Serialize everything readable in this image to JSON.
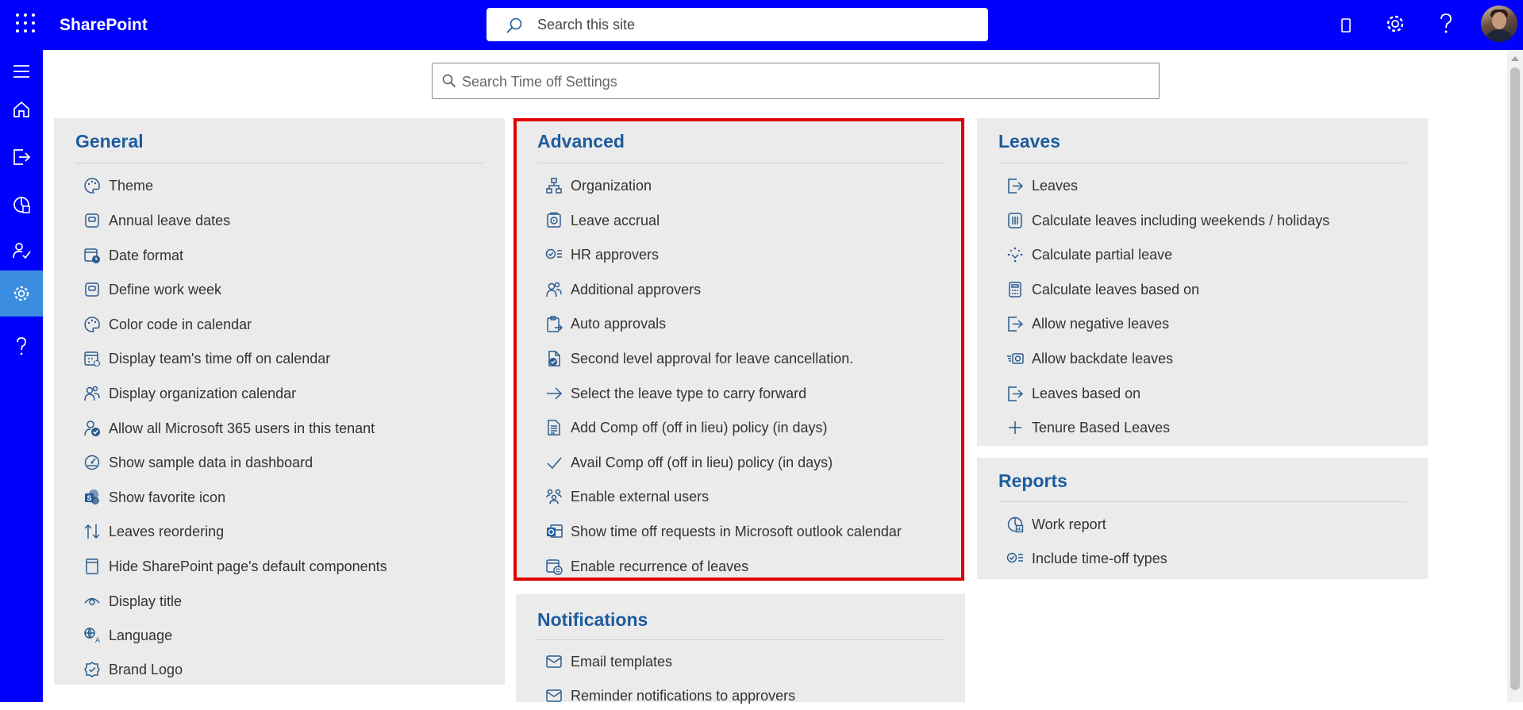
{
  "topbar": {
    "brand": "SharePoint",
    "search_placeholder": "Search this site",
    "colors": {
      "background": "#0000ff",
      "rail_active": "#3a8de0",
      "heading": "#1d5c9e",
      "highlight_border": "#e00000"
    }
  },
  "toolbar_icons": [
    "app-launcher-icon",
    "mobile-icon",
    "settings-gear-icon",
    "help-icon",
    "avatar"
  ],
  "left_rail": [
    "menu-icon",
    "home-icon",
    "leave-exit-icon",
    "report-icon",
    "user-approve-icon",
    "settings-gear-icon",
    "help-icon"
  ],
  "settings_search": {
    "placeholder": "Search Time off Settings"
  },
  "panels": {
    "general": {
      "title": "General",
      "items": [
        {
          "label": "Theme",
          "icon": "palette-icon"
        },
        {
          "label": "Annual leave dates",
          "icon": "calendar-box-icon"
        },
        {
          "label": "Date format",
          "icon": "calendar-clock-icon"
        },
        {
          "label": "Define work week",
          "icon": "calendar-box-icon"
        },
        {
          "label": "Color code in calendar",
          "icon": "palette-icon"
        },
        {
          "label": "Display team's time off on calendar",
          "icon": "calendar-settings-icon"
        },
        {
          "label": "Display organization calendar",
          "icon": "people-icon"
        },
        {
          "label": "Allow all Microsoft 365 users in this tenant",
          "icon": "person-check-icon"
        },
        {
          "label": "Show sample data in dashboard",
          "icon": "gauge-icon"
        },
        {
          "label": "Show favorite icon",
          "icon": "sharepoint-logo-icon"
        },
        {
          "label": "Leaves reordering",
          "icon": "up-down-arrow-icon"
        },
        {
          "label": "Hide SharePoint page's default components",
          "icon": "page-icon"
        },
        {
          "label": "Display title",
          "icon": "eye-icon"
        },
        {
          "label": "Language",
          "icon": "language-icon"
        },
        {
          "label": "Brand Logo",
          "icon": "badge-icon"
        }
      ]
    },
    "advanced": {
      "title": "Advanced",
      "items": [
        {
          "label": "Organization",
          "icon": "org-chart-icon"
        },
        {
          "label": "Leave accrual",
          "icon": "safe-icon"
        },
        {
          "label": "HR approvers",
          "icon": "checklist-icon"
        },
        {
          "label": "Additional approvers",
          "icon": "people-icon"
        },
        {
          "label": "Auto approvals",
          "icon": "clipboard-arrow-icon"
        },
        {
          "label": "Second level approval for leave cancellation.",
          "icon": "document-check-icon"
        },
        {
          "label": "Select the leave type to carry forward",
          "icon": "arrow-right-icon"
        },
        {
          "label": "Add Comp off (off in lieu) policy (in days)",
          "icon": "document-lines-icon"
        },
        {
          "label": "Avail Comp off (off in lieu) policy (in days)",
          "icon": "checkmark-icon"
        },
        {
          "label": "Enable external users",
          "icon": "group-icon"
        },
        {
          "label": "Show time off requests in Microsoft outlook calendar",
          "icon": "outlook-icon"
        },
        {
          "label": "Enable recurrence of leaves",
          "icon": "calendar-repeat-icon"
        }
      ]
    },
    "notifications": {
      "title": "Notifications",
      "items": [
        {
          "label": "Email templates",
          "icon": "mail-icon"
        },
        {
          "label": "Reminder notifications to approvers",
          "icon": "mail-icon"
        }
      ]
    },
    "leaves": {
      "title": "Leaves",
      "items": [
        {
          "label": "Leaves",
          "icon": "leave-exit-icon"
        },
        {
          "label": "Calculate leaves including weekends / holidays",
          "icon": "columns-icon"
        },
        {
          "label": "Calculate partial leave",
          "icon": "partial-dots-icon"
        },
        {
          "label": "Calculate leaves based on",
          "icon": "calculator-icon"
        },
        {
          "label": "Allow negative leaves",
          "icon": "leave-exit-icon"
        },
        {
          "label": "Allow backdate leaves",
          "icon": "backdate-icon"
        },
        {
          "label": "Leaves based on",
          "icon": "leave-exit-icon"
        },
        {
          "label": "Tenure Based Leaves",
          "icon": "plus-icon"
        }
      ]
    },
    "reports": {
      "title": "Reports",
      "items": [
        {
          "label": "Work report",
          "icon": "report-icon"
        },
        {
          "label": "Include time-off types",
          "icon": "checklist-icon"
        }
      ]
    }
  }
}
